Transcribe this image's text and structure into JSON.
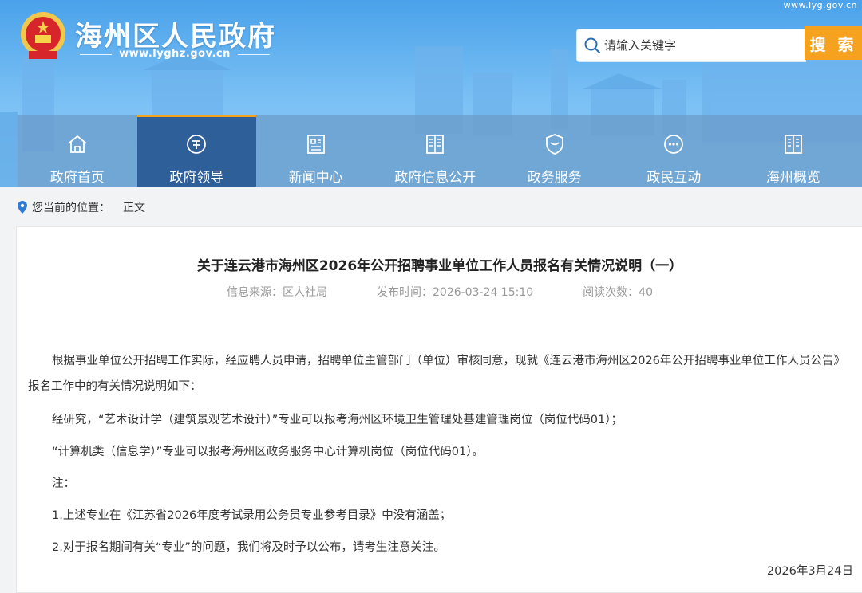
{
  "header": {
    "site_title": "海州区人民政府",
    "site_url": "www.lyghz.gov.cn",
    "top_url": "www.lyg.gov.cn",
    "search": {
      "placeholder": "请输入关键字",
      "button_label": "搜 索"
    }
  },
  "nav": {
    "items": [
      {
        "label": "政府首页",
        "icon": "home-icon",
        "active": false
      },
      {
        "label": "政府领导",
        "icon": "leader-icon",
        "active": true
      },
      {
        "label": "新闻中心",
        "icon": "news-icon",
        "active": false
      },
      {
        "label": "政府信息公开",
        "icon": "info-icon",
        "active": false
      },
      {
        "label": "政务服务",
        "icon": "service-shield-icon",
        "active": false
      },
      {
        "label": "政民互动",
        "icon": "chat-icon",
        "active": false
      },
      {
        "label": "海州概览",
        "icon": "book-icon",
        "active": false
      }
    ]
  },
  "breadcrumb": {
    "prefix": "您当前的位置：",
    "current": "正文"
  },
  "article": {
    "title": "关于连云港市海州区2026年公开招聘事业单位工作人员报名有关情况说明（一）",
    "meta": {
      "source": "信息来源：区人社局",
      "publish_time": "发布时间：2026-03-24 15:10",
      "views": "阅读次数：40"
    },
    "paragraphs": [
      "根据事业单位公开招聘工作实际，经应聘人员申请，招聘单位主管部门（单位）审核同意，现就《连云港市海州区2026年公开招聘事业单位工作人员公告》报名工作中的有关情况说明如下：",
      "经研究，“艺术设计学（建筑景观艺术设计）”专业可以报考海州区环境卫生管理处基建管理岗位（岗位代码01）；",
      "“计算机类（信息学）”专业可以报考海州区政务服务中心计算机岗位（岗位代码01）。",
      "注：",
      "1.上述专业在《江苏省2026年度考试录用公务员专业参考目录》中没有涵盖；",
      "2.对于报名期间有关“专业”的问题，我们将及时予以公布，请考生注意关注。"
    ],
    "date": "2026年3月24日"
  },
  "colors": {
    "header_blue": "#4aa2ea",
    "nav_active": "#2f5f99",
    "accent_orange": "#f6a21e"
  }
}
